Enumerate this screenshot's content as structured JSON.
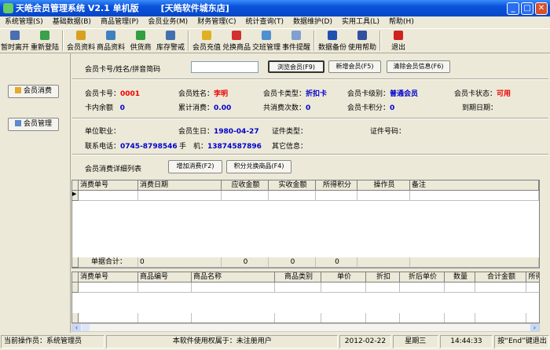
{
  "window": {
    "title": "天皓会员管理系统 V2.1 单机版",
    "store": "[天皓软件城东店]"
  },
  "menu": [
    "系统管理(S)",
    "基础数据(B)",
    "商品管理(P)",
    "会员业务(M)",
    "财务管理(C)",
    "统计查询(T)",
    "数据维护(D)",
    "实用工具(L)",
    "帮助(H)"
  ],
  "toolbar": [
    {
      "label": "暂时离开",
      "color": "#4a6fb0"
    },
    {
      "label": "重新登陆",
      "color": "#3aa04a"
    },
    {
      "sep": true
    },
    {
      "label": "会员资料",
      "color": "#d8a020"
    },
    {
      "label": "商品资料",
      "color": "#4080c0"
    },
    {
      "label": "供货商",
      "color": "#30a040"
    },
    {
      "label": "库存警戒",
      "color": "#4070b0"
    },
    {
      "sep": true
    },
    {
      "label": "会员充值",
      "color": "#e0b020"
    },
    {
      "label": "兑换商品",
      "color": "#d03030"
    },
    {
      "label": "交班管理",
      "color": "#5090d0"
    },
    {
      "label": "事件提醒",
      "color": "#80a0d0"
    },
    {
      "sep": true
    },
    {
      "label": "数据备份",
      "color": "#2050b0"
    },
    {
      "label": "使用帮助",
      "color": "#3050a0"
    },
    {
      "sep": true
    },
    {
      "label": "退出",
      "color": "#d02020"
    }
  ],
  "sidebar": {
    "consume": "会员消费",
    "manage": "会员管理"
  },
  "search": {
    "label": "会员卡号/姓名/拼音简码",
    "value": "",
    "browse": "浏览会员(F9)",
    "add": "新增会员(F5)",
    "clear": "清除会员信息(F6)"
  },
  "member": {
    "card_no_label": "会员卡号：",
    "card_no": "0001",
    "name_label": "会员姓名：",
    "name": "李明",
    "card_type_label": "会员卡类型：",
    "card_type": "折扣卡",
    "level_label": "会员卡级别：",
    "level": "普通会员",
    "status_label": "会员卡状态：",
    "status": "可用",
    "balance_label": "卡内余额",
    "balance": "0",
    "total_label": "累计消费：",
    "total": "0.00",
    "count_label": "共消费次数：",
    "count": "0",
    "points_label": "会员卡积分：",
    "points": "0",
    "expire_label": "到期日期：",
    "job_label": "单位职业：",
    "birthday_label": "会员生日：",
    "birthday": "1980-04-27",
    "idtype_label": "证件类型：",
    "idno_label": "证件号码：",
    "phone_label": "联系电话：",
    "phone": "0745-8798546",
    "mobile_label": "手　机：",
    "mobile": "13874587896",
    "other_label": "其它信息："
  },
  "detail": {
    "label": "会员消费详细列表",
    "add": "增加消费(F2)",
    "exchange": "积分兑换商品(F4)"
  },
  "grid1": {
    "columns": [
      "消费单号",
      "消费日期",
      "应收金额",
      "实收金额",
      "所得积分",
      "操作员",
      "备注"
    ],
    "summary": [
      "单据合计：",
      "0",
      "0",
      "0",
      "0"
    ]
  },
  "grid2": {
    "columns": [
      "消费单号",
      "商品编号",
      "商品名称",
      "商品类别",
      "单价",
      "折扣",
      "折后单价",
      "数量",
      "合计金额",
      "所得积分"
    ]
  },
  "statusbar": [
    "当前操作员：系统管理员",
    "本软件使用权属于：未注册用户",
    "2012-02-22",
    "星期三",
    "14:44:33",
    "按“End”键退出"
  ]
}
